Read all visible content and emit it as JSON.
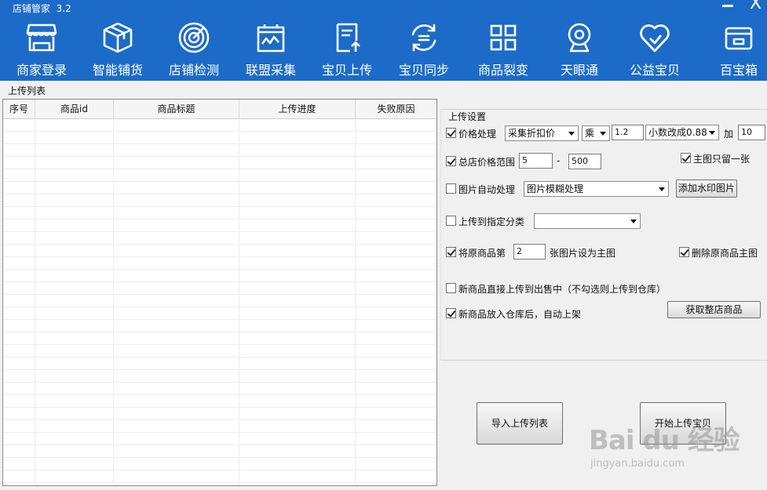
{
  "window": {
    "title": "店铺管家  3.2"
  },
  "nav": [
    {
      "label": "商家登录",
      "icon": "shop-icon"
    },
    {
      "label": "智能铺货",
      "icon": "box-icon"
    },
    {
      "label": "店铺检测",
      "icon": "radar-icon"
    },
    {
      "label": "联盟采集",
      "icon": "chart-board-icon"
    },
    {
      "label": "宝贝上传",
      "icon": "upload-doc-icon"
    },
    {
      "label": "宝贝同步",
      "icon": "sync-icon"
    },
    {
      "label": "商品裂变",
      "icon": "grid-icon"
    },
    {
      "label": "天眼通",
      "icon": "webcam-icon"
    },
    {
      "label": "公益宝贝",
      "icon": "heart-icon"
    },
    {
      "label": "百宝箱",
      "icon": "wallet-icon"
    }
  ],
  "upload_list": {
    "legend": "上传列表",
    "columns": [
      "序号",
      "商品id",
      "商品标题",
      "上传进度",
      "失败原因"
    ]
  },
  "settings": {
    "legend": "上传设置",
    "price": {
      "checked": true,
      "label": "价格处理",
      "mode": "采集折扣价",
      "operator": "乘",
      "factor": "1.2",
      "decimal": "小数改成0.88",
      "add_label": "加",
      "add_value": "10"
    },
    "range": {
      "checked": true,
      "label": "总店价格范围",
      "min": "5",
      "dash": "-",
      "max": "500"
    },
    "main_only": {
      "checked": true,
      "label": "主图只留一张"
    },
    "image_auto": {
      "checked": false,
      "label": "图片自动处理",
      "mode": "图片模糊处理",
      "watermark_button": "添加水印图片"
    },
    "category": {
      "checked": false,
      "label": "上传到指定分类",
      "value": ""
    },
    "set_main": {
      "checked": true,
      "label_pre": "将原商品第",
      "index": "2",
      "label_post": "张图片设为主图"
    },
    "delete_main": {
      "checked": true,
      "label": "删除原商品主图"
    },
    "direct_sale": {
      "checked": false,
      "label": "新商品直接上传到出售中（不勾选则上传到仓库）"
    },
    "auto_shelf": {
      "checked": true,
      "label": "新商品放入仓库后，自动上架"
    },
    "fetch_button": "获取整店商品"
  },
  "actions": {
    "import": "导入上传列表",
    "start": "开始上传宝贝"
  },
  "watermark": {
    "main": "Bai du 经验",
    "sub": "jingyan.baidu.com"
  },
  "colors": {
    "header": "#1c6bc8"
  }
}
